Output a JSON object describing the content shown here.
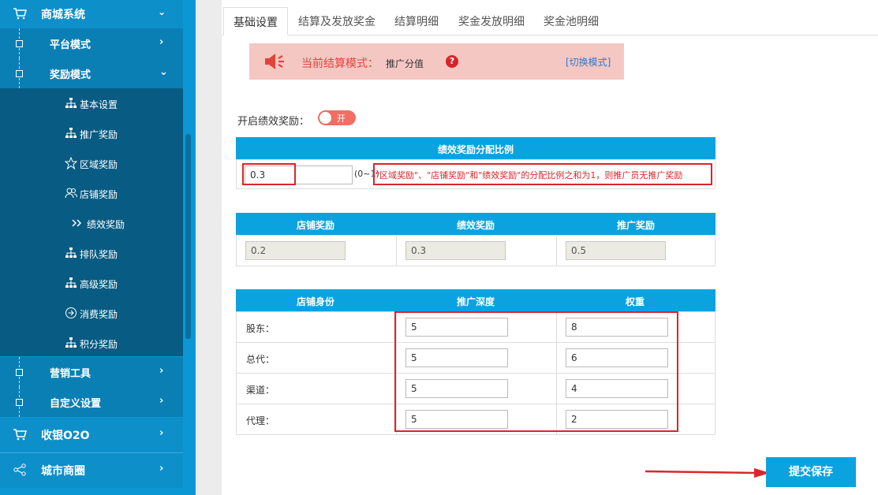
{
  "sidebar": {
    "top": {
      "label": "商城系统"
    },
    "subs": [
      {
        "label": "平台模式"
      },
      {
        "label": "奖励模式"
      }
    ],
    "leaves": [
      {
        "label": "基本设置",
        "icon": "sitemap-icon"
      },
      {
        "label": "推广奖励",
        "icon": "sitemap-icon"
      },
      {
        "label": "区域奖励",
        "icon": "star-icon"
      },
      {
        "label": "店铺奖励",
        "icon": "users-icon"
      },
      {
        "label": "绩效奖励",
        "icon": "double-chevron-icon"
      },
      {
        "label": "排队奖励",
        "icon": "sitemap-icon"
      },
      {
        "label": "高级奖励",
        "icon": "sitemap-icon"
      },
      {
        "label": "消费奖励",
        "icon": "arrow-circle-icon"
      },
      {
        "label": "积分奖励",
        "icon": "sitemap-icon"
      }
    ],
    "subs2": [
      {
        "label": "营销工具"
      },
      {
        "label": "自定义设置"
      }
    ],
    "mains": [
      {
        "label": "收银O2O"
      },
      {
        "label": "城市商圈"
      }
    ]
  },
  "tabs": [
    "基础设置",
    "结算及发放奖金",
    "结算明细",
    "奖金发放明细",
    "奖金池明细"
  ],
  "mode": {
    "label": "当前结算模式：",
    "value": "推广分值",
    "help": "?",
    "switch": "[切换模式]"
  },
  "perf": {
    "label": "开启绩效奖励：",
    "toggle": "开"
  },
  "ratio": {
    "header": "绩效奖励分配比例",
    "value": "0.3",
    "range": "(0~1)",
    "note": "\"区域奖励\"、\"店铺奖励\"和\"绩效奖励\"的分配比例之和为1，则推广员无推广奖励"
  },
  "split": {
    "headers": [
      "店铺奖励",
      "绩效奖励",
      "推广奖励"
    ],
    "values": [
      "0.2",
      "0.3",
      "0.5"
    ]
  },
  "identity": {
    "headers": [
      "店铺身份",
      "推广深度",
      "权重"
    ],
    "rows": [
      {
        "name": "股东：",
        "depth": "5",
        "weight": "8"
      },
      {
        "name": "总代：",
        "depth": "5",
        "weight": "6"
      },
      {
        "name": "渠道：",
        "depth": "5",
        "weight": "4"
      },
      {
        "name": "代理：",
        "depth": "5",
        "weight": "2"
      }
    ]
  },
  "submit": "提交保存",
  "colors": {
    "primary": "#0ba3df",
    "sidebar": "#0d8fc9",
    "sidebar_dark": "#085b82",
    "alert_bg": "#f5c7c3",
    "alert_text": "#e5433a",
    "annotation": "#d9262c"
  }
}
